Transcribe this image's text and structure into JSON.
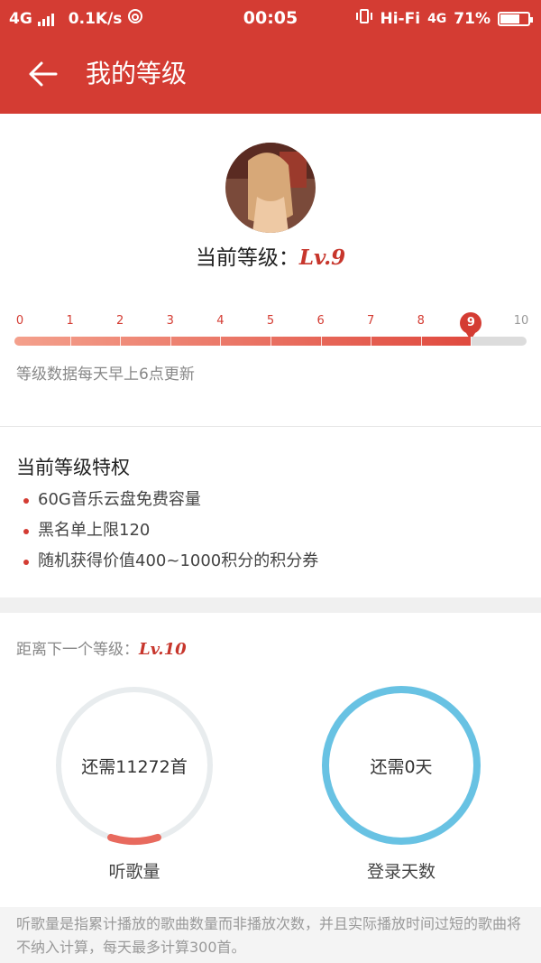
{
  "status": {
    "network": "4G",
    "speed": "0.1K/s",
    "time": "00:05",
    "audio": "Hi-Fi",
    "network_right": "4G",
    "battery": "71%",
    "battery_level": 0.71
  },
  "header": {
    "title": "我的等级"
  },
  "level": {
    "current_prefix": "当前等级：",
    "current_value": "Lv.9",
    "ticks": [
      "0",
      "1",
      "2",
      "3",
      "4",
      "5",
      "6",
      "7",
      "8",
      "9",
      "10"
    ],
    "current_index": 9,
    "update_note": "等级数据每天早上6点更新"
  },
  "privileges": {
    "title": "当前等级特权",
    "items": [
      "60G音乐云盘免费容量",
      "黑名单上限120",
      "随机获得价值400~1000积分的积分券"
    ]
  },
  "next": {
    "label_prefix": "距离下一个等级：",
    "label_value": "Lv.10",
    "songs": {
      "text": "还需11272首",
      "label": "听歌量",
      "progress": 0.1,
      "color": "#e86a5e"
    },
    "days": {
      "text": "还需0天",
      "label": "登录天数",
      "progress": 1.0,
      "color": "#68c2e3"
    }
  },
  "footer_note": "听歌量是指累计播放的歌曲数量而非播放次数，并且实际播放时间过短的歌曲将不纳入计算，每天最多计算300首。",
  "colors": {
    "accent": "#d43c33",
    "track": "#e8ecee"
  }
}
